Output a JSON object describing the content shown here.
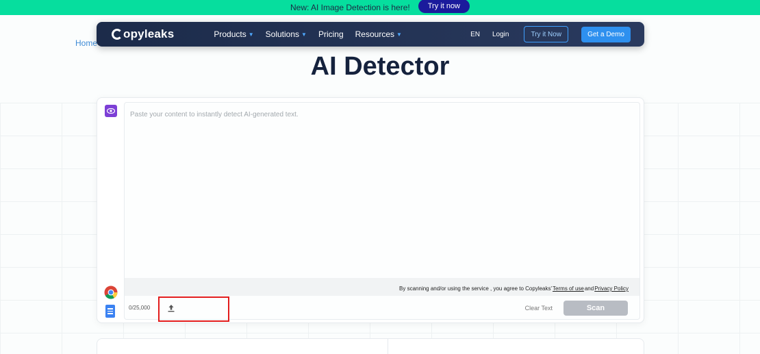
{
  "announcement": {
    "text": "New: AI Image Detection is here!",
    "button": "Try it now"
  },
  "breadcrumb": "Home",
  "navbar": {
    "logo": "opyleaks",
    "menu": [
      "Products",
      "Solutions",
      "Pricing",
      "Resources"
    ],
    "language": "EN",
    "login": "Login",
    "try_button": "Try it Now",
    "demo_button": "Get a Demo"
  },
  "page_title": "AI Detector",
  "editor": {
    "placeholder": "Paste your content to instantly detect AI-generated text.",
    "terms_prefix": "By scanning and/or using the service , you agree to Copyleaks'",
    "terms_link": "Terms of use",
    "terms_and": "and",
    "privacy_link": "Privacy Policy",
    "counter": "0/25,000",
    "clear_text": "Clear Text",
    "scan_button": "Scan"
  },
  "colors": {
    "announcement_bg": "#06de9e",
    "nav_bg": "#1c2b4a",
    "accent_blue": "#2e90ef",
    "highlight_red": "#e21c1c",
    "scan_disabled": "#b8bcc3"
  }
}
